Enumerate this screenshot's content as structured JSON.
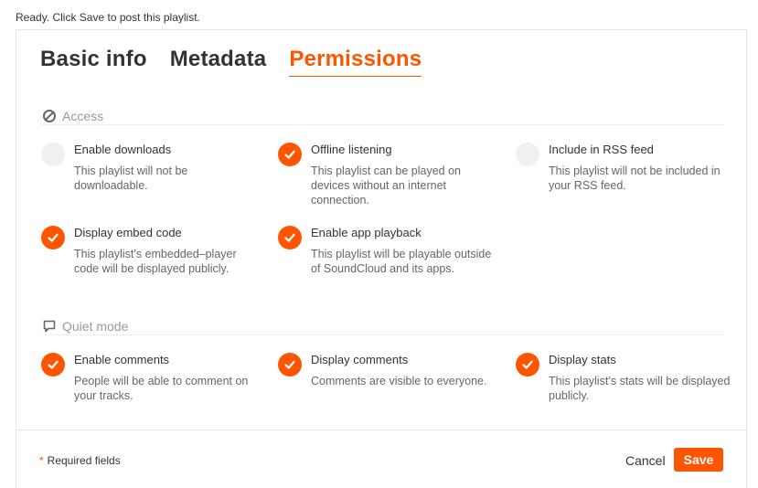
{
  "status_text": "Ready. Click Save to post this playlist.",
  "tabs": [
    {
      "label": "Basic info",
      "active": false
    },
    {
      "label": "Metadata",
      "active": false
    },
    {
      "label": "Permissions",
      "active": true
    }
  ],
  "access": {
    "label": "Access",
    "icon": "no-entry-icon",
    "options": [
      {
        "title": "Enable downloads",
        "description": "This playlist will not be downloadable.",
        "checked": false
      },
      {
        "title": "Offline listening",
        "description": "This playlist can be played on devices without an internet connection.",
        "checked": true
      },
      {
        "title": "Include in RSS feed",
        "description": "This playlist will not be included in your RSS feed.",
        "checked": false
      },
      {
        "title": "Display embed code",
        "description": "This playlist’s embedded–player code will be displayed publicly.",
        "checked": true
      },
      {
        "title": "Enable app playback",
        "description": "This playlist will be playable outside of SoundCloud and its apps.",
        "checked": true
      }
    ]
  },
  "quiet_mode": {
    "label": "Quiet mode",
    "icon": "speech-bubble-icon",
    "options": [
      {
        "title": "Enable comments",
        "description": "People will be able to comment on your tracks.",
        "checked": true
      },
      {
        "title": "Display comments",
        "description": "Comments are visible to everyone.",
        "checked": true
      },
      {
        "title": "Display stats",
        "description": "This playlist’s stats will be displayed publicly.",
        "checked": true
      }
    ]
  },
  "footer": {
    "required_star": "*",
    "required_label": "Required fields",
    "cancel_label": "Cancel",
    "save_label": "Save"
  },
  "colors": {
    "accent": "#ff5500",
    "unchecked": "#f0f0f0",
    "muted": "#999999"
  }
}
